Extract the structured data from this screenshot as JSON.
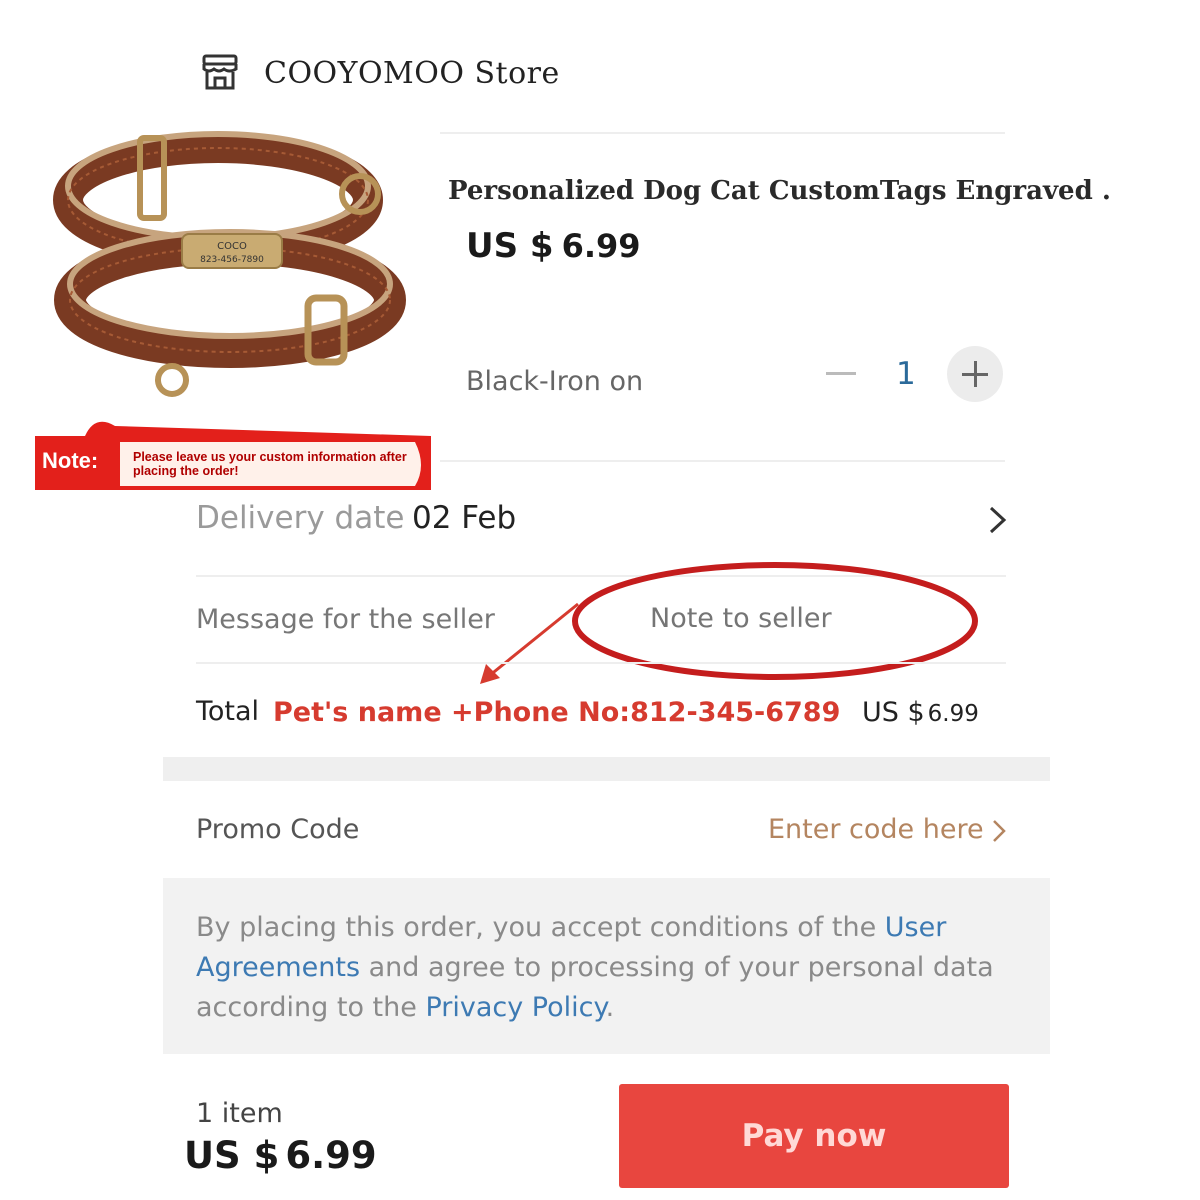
{
  "store": {
    "icon": "store-icon",
    "name": "COOYOMOO  Store"
  },
  "product": {
    "title": "Personalized Dog Cat CustomTags Engraved .",
    "price_currency": "US $",
    "price_value": "6.99",
    "tag_name": "COCO",
    "tag_phone": "823-456-7890",
    "variant": "Black-Iron on",
    "quantity": "1"
  },
  "note_banner": {
    "label": "Note:",
    "text": "Please leave us your custom information after placing the order!",
    "color": "#e3201b"
  },
  "delivery": {
    "label": "Delivery date",
    "value": "02 Feb"
  },
  "message": {
    "label": "Message for the seller",
    "placeholder": "Note to seller"
  },
  "total": {
    "label": "Total",
    "annotation": "Pet's name +Phone No:812-345-6789",
    "currency": "US $",
    "value": "6.99"
  },
  "promo": {
    "label": "Promo Code",
    "link": "Enter code here"
  },
  "terms": {
    "part1": "By placing this order, you accept conditions of the ",
    "link1": "User Agreements",
    "part2": " and agree to processing of your personal data according to the ",
    "link2": "Privacy Policy",
    "part3": "."
  },
  "footer": {
    "items": "1 item",
    "currency": "US $",
    "value": "6.99",
    "pay_label": "Pay now",
    "pay_color": "#e8463f"
  }
}
